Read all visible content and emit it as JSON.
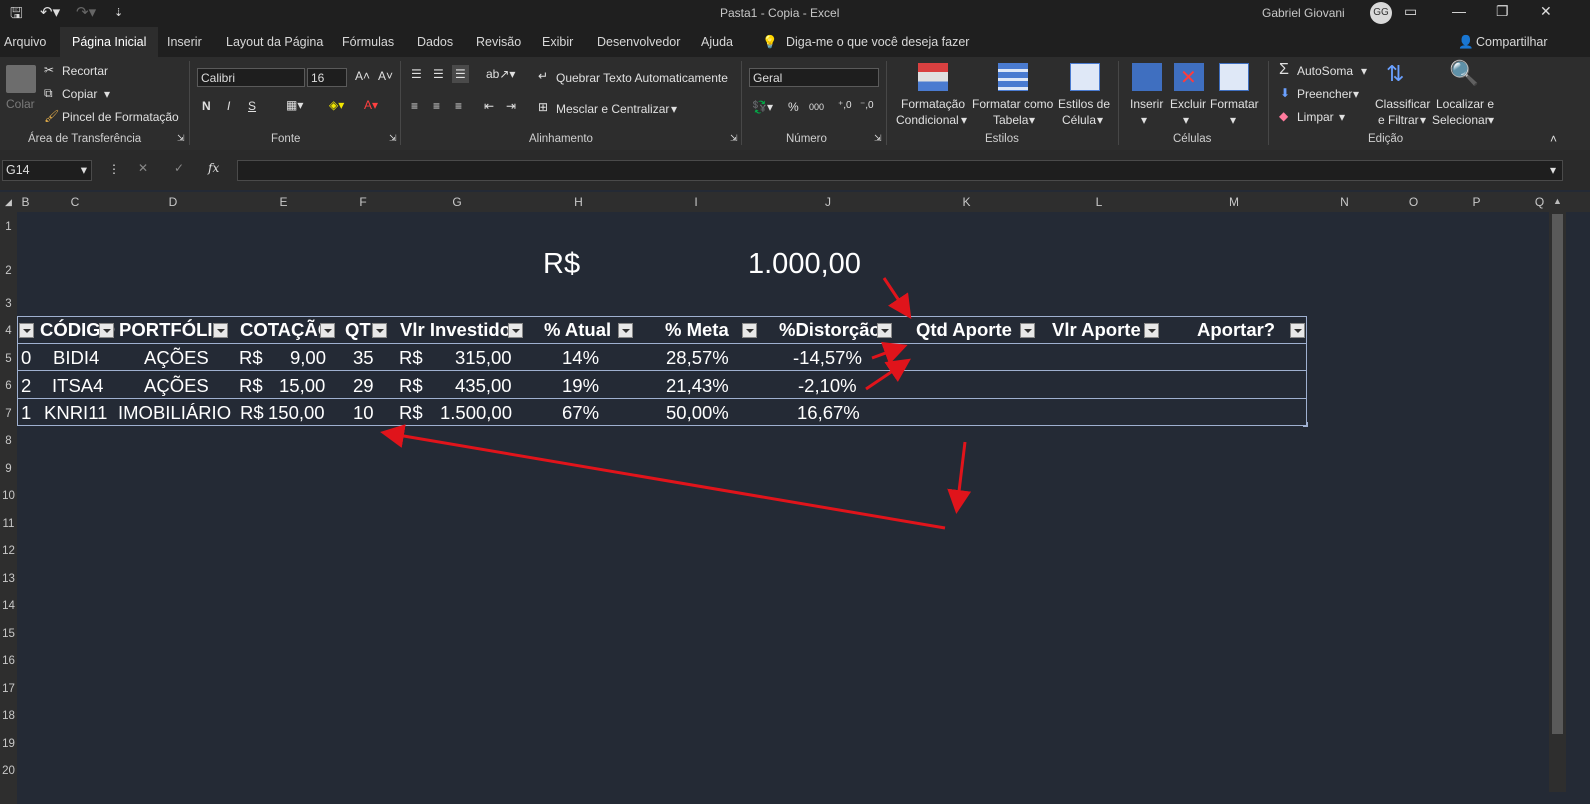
{
  "window": {
    "doc_title": "Pasta1 - Copia  -  Excel",
    "user_name": "Gabriel Giovani",
    "user_initials": "GG"
  },
  "menu": {
    "tabs": [
      "Arquivo",
      "Página Inicial",
      "Inserir",
      "Layout da Página",
      "Fórmulas",
      "Dados",
      "Revisão",
      "Exibir",
      "Desenvolvedor",
      "Ajuda"
    ],
    "tell_me": "Diga-me o que você deseja fazer",
    "share": "Compartilhar"
  },
  "ribbon": {
    "clipboard": {
      "paste": "Colar",
      "cut": "Recortar",
      "copy": "Copiar",
      "format_painter": "Pincel de Formatação",
      "group": "Área de Transferência"
    },
    "font": {
      "name": "Calibri",
      "size": "16",
      "bold": "N",
      "italic": "I",
      "underline": "S",
      "group": "Fonte"
    },
    "alignment": {
      "wrap": "Quebrar Texto Automaticamente",
      "merge": "Mesclar e Centralizar",
      "group": "Alinhamento"
    },
    "number": {
      "format": "Geral",
      "percent": "%",
      "thousands": "000",
      "group": "Número"
    },
    "styles": {
      "cond_1": "Formatação",
      "cond_2": "Condicional",
      "table_1": "Formatar como",
      "table_2": "Tabela",
      "cell_1": "Estilos de",
      "cell_2": "Célula",
      "group": "Estilos"
    },
    "cells": {
      "insert": "Inserir",
      "delete": "Excluir",
      "format": "Formatar",
      "group": "Células"
    },
    "editing": {
      "autosum": "AutoSoma",
      "fill": "Preencher",
      "clear": "Limpar",
      "sort_1": "Classificar",
      "sort_2": "e Filtrar",
      "find_1": "Localizar e",
      "find_2": "Selecionar",
      "group": "Edição"
    }
  },
  "formula_bar": {
    "name_box": "G14",
    "fx": "fx",
    "formula": ""
  },
  "columns": [
    "B",
    "C",
    "D",
    "E",
    "F",
    "G",
    "H",
    "I",
    "J",
    "K",
    "L",
    "M",
    "N",
    "O",
    "P",
    "Q"
  ],
  "rows": [
    "1",
    "2",
    "3",
    "4",
    "5",
    "6",
    "7",
    "8",
    "9",
    "10",
    "11",
    "12",
    "13",
    "14",
    "15",
    "16",
    "17",
    "18",
    "19",
    "20"
  ],
  "sheet": {
    "total_currency": "R$",
    "total_value": "1.000,00",
    "headers": {
      "idx": "",
      "codigo": "CÓDIGO",
      "portfolio": "PORTFÓLIO",
      "cotacao": "COTAÇÃO",
      "qtd": "QTD",
      "vlr_investido": "Vlr Investido",
      "pct_atual": "% Atual",
      "pct_meta": "% Meta",
      "distorcao": "%Distorção",
      "qtd_aporte": "Qtd Aporte",
      "vlr_aporte": "Vlr Aporte",
      "aportar": "Aportar?"
    },
    "data_rows": [
      {
        "idx": "0",
        "codigo": "BIDI4",
        "portfolio": "AÇÕES",
        "cot_cur": "R$",
        "cotacao": "9,00",
        "qtd": "35",
        "inv_cur": "R$",
        "investido": "315,00",
        "atual": "14%",
        "meta": "28,57%",
        "distorcao": "-14,57%"
      },
      {
        "idx": "2",
        "codigo": "ITSA4",
        "portfolio": "AÇÕES",
        "cot_cur": "R$",
        "cotacao": "15,00",
        "qtd": "29",
        "inv_cur": "R$",
        "investido": "435,00",
        "atual": "19%",
        "meta": "21,43%",
        "distorcao": "-2,10%"
      },
      {
        "idx": "1",
        "codigo": "KNRI11",
        "portfolio": "IMOBILIÁRIO",
        "cot_cur": "R$",
        "cotacao": "150,00",
        "qtd": "10",
        "inv_cur": "R$",
        "investido": "1.500,00",
        "atual": "67%",
        "meta": "50,00%",
        "distorcao": "16,67%"
      }
    ]
  },
  "annotation_color": "#e0141b"
}
